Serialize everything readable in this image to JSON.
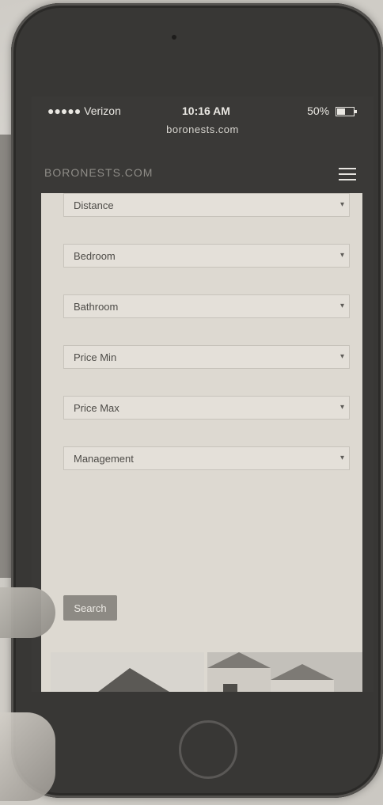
{
  "status_bar": {
    "carrier": "●●●●● Verizon",
    "time": "10:16 AM",
    "battery": "50%"
  },
  "browser": {
    "url": "boronests.com"
  },
  "site": {
    "logo": "BORONESTS.COM"
  },
  "form": {
    "fields": [
      {
        "label": "Distance"
      },
      {
        "label": "Bedroom"
      },
      {
        "label": "Bathroom"
      },
      {
        "label": "Price Min"
      },
      {
        "label": "Price Max"
      },
      {
        "label": "Management"
      }
    ],
    "search_label": "Search"
  },
  "icons": {
    "menu": "hamburger-icon",
    "wifi": "wifi-icon",
    "battery": "battery-icon"
  },
  "colors": {
    "screen_bg": "#3a3937",
    "content_bg": "#ddd9d1",
    "button_bg": "#8d8a84"
  }
}
